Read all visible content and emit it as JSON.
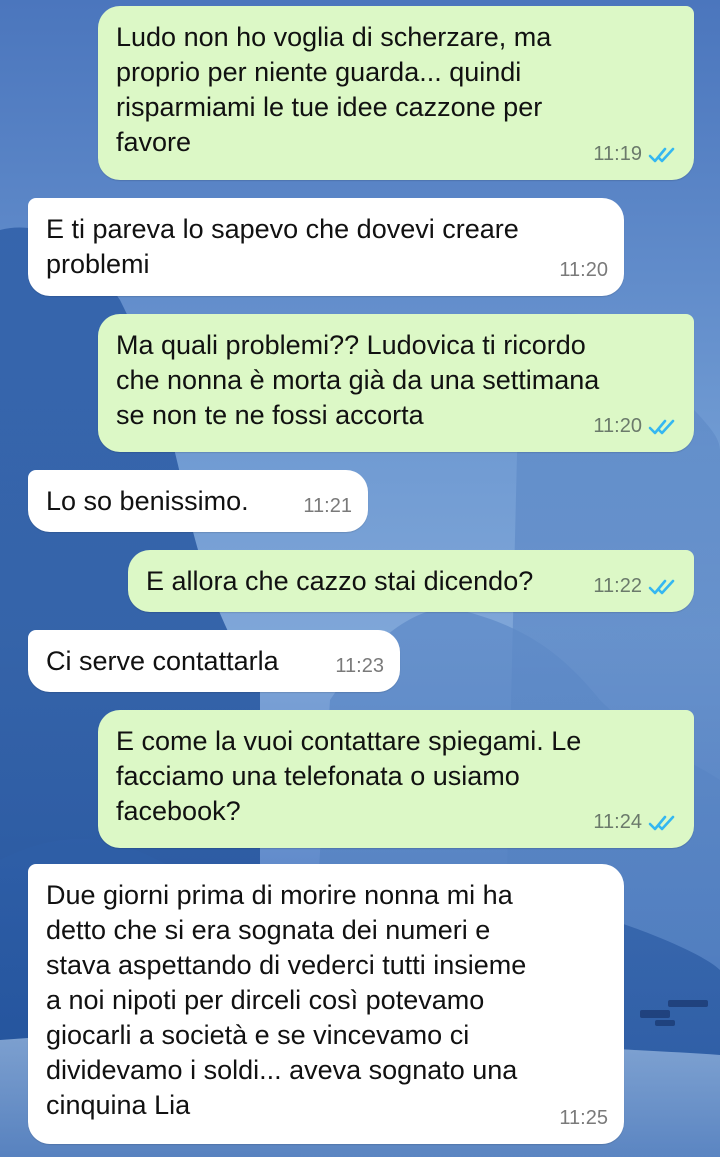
{
  "chat": {
    "messages": [
      {
        "direction": "out",
        "text": "Ludo non ho voglia di scherzare, ma\nproprio per niente guarda... quindi\nrisparmiami le tue idee cazzone per\nfavore",
        "time": "11:19",
        "status": "read"
      },
      {
        "direction": "in",
        "text": "E ti pareva lo sapevo che dovevi creare\nproblemi",
        "time": "11:20"
      },
      {
        "direction": "out",
        "text": "Ma quali problemi?? Ludovica ti ricordo\nche nonna è morta già da una settimana\nse non te ne fossi accorta",
        "time": "11:20",
        "status": "read"
      },
      {
        "direction": "in",
        "text": "Lo so benissimo.",
        "time": "11:21"
      },
      {
        "direction": "out",
        "text": "E allora che cazzo stai dicendo?",
        "time": "11:22",
        "status": "read"
      },
      {
        "direction": "in",
        "text": "Ci serve contattarla",
        "time": "11:23"
      },
      {
        "direction": "out",
        "text": "E come la vuoi contattare spiegami. Le\nfacciamo una telefonata o usiamo\nfacebook?",
        "time": "11:24",
        "status": "read"
      },
      {
        "direction": "in",
        "text": "Due giorni prima di morire nonna mi ha\ndetto che si era sognata dei numeri e\nstava aspettando di vederci tutti insieme\na noi nipoti per dirceli così potevamo\ngiocarli a società e se vincevamo ci\ndividevamo i soldi... aveva sognato una\ncinquina Lia",
        "time": "11:25"
      }
    ]
  },
  "colors": {
    "outgoing_bubble": "#dcf8c6",
    "incoming_bubble": "#ffffff",
    "read_ticks": "#34b7f1"
  },
  "icons": {
    "read_receipt": "double-check-icon"
  }
}
